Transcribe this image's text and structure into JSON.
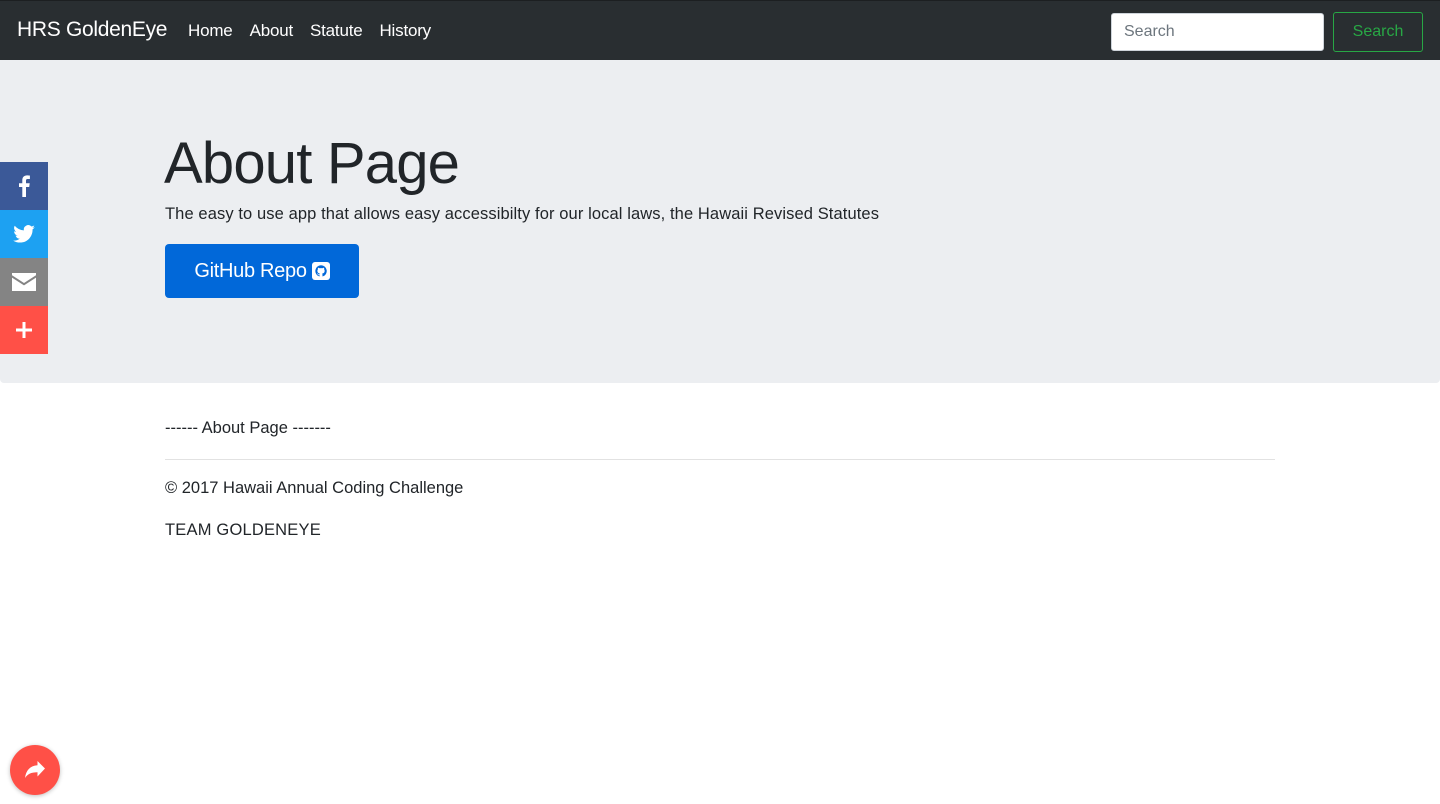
{
  "navbar": {
    "brand": "HRS GoldenEye",
    "links": [
      "Home",
      "About",
      "Statute",
      "History"
    ],
    "search_placeholder": "Search",
    "search_button": "Search"
  },
  "jumbotron": {
    "title": "About Page",
    "lead": "The easy to use app that allows easy accessibilty for our local laws, the Hawaii Revised Statutes",
    "github_button": "GitHub Repo"
  },
  "share_bar": {
    "items": [
      "facebook-icon",
      "twitter-icon",
      "email-icon",
      "plus-icon"
    ],
    "colors": {
      "facebook": "#3b5998",
      "twitter": "#1da1f2",
      "email": "#848484",
      "more": "#ff5047"
    }
  },
  "content": {
    "divider_text": "------ About Page -------",
    "copyright": "© 2017 Hawaii Annual Coding Challenge",
    "team": "TEAM GOLDENEYE"
  },
  "floating_share": {
    "icon": "share-arrow-icon",
    "color": "#ff5047"
  }
}
